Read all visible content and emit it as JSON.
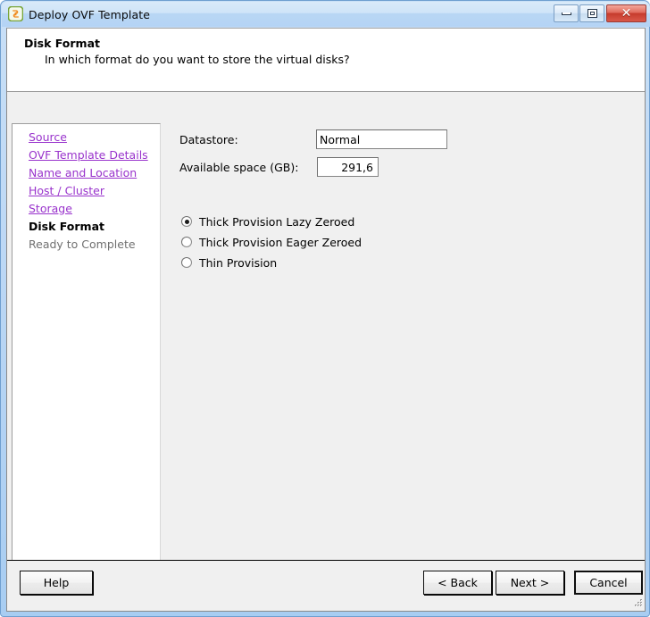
{
  "window": {
    "title": "Deploy OVF Template",
    "icon": "vsphere-ovf-icon",
    "minimize_label": "Minimize",
    "maximize_label": "Maximize",
    "close_label": "Close",
    "accent_color": "#b4d3f5",
    "link_color": "#9933cc"
  },
  "header": {
    "title": "Disk Format",
    "subtitle": "In which format do you want to store the virtual disks?"
  },
  "sidebar": {
    "steps": [
      {
        "label": "Source",
        "state": "link"
      },
      {
        "label": "OVF Template Details",
        "state": "link"
      },
      {
        "label": "Name and Location",
        "state": "link"
      },
      {
        "label": "Host / Cluster",
        "state": "link"
      },
      {
        "label": "Storage",
        "state": "link"
      },
      {
        "label": "Disk Format",
        "state": "current"
      },
      {
        "label": "Ready to Complete",
        "state": "pending"
      }
    ]
  },
  "content": {
    "datastore": {
      "label": "Datastore:",
      "value": "Normal",
      "placeholder": ""
    },
    "available_space": {
      "label": "Available space (GB):",
      "value": "291,6",
      "placeholder": ""
    },
    "disk_format_options": [
      {
        "label": "Thick Provision Lazy Zeroed",
        "selected": true
      },
      {
        "label": "Thick Provision Eager Zeroed",
        "selected": false
      },
      {
        "label": "Thin Provision",
        "selected": false
      }
    ]
  },
  "footer": {
    "help_label": "Help",
    "back_label": "< Back",
    "next_label": "Next >",
    "cancel_label": "Cancel"
  }
}
